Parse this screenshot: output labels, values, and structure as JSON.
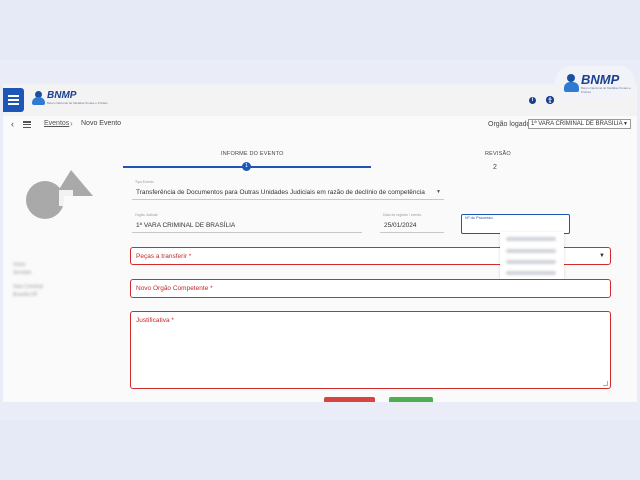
{
  "header": {
    "logo_name": "BNMP",
    "logo_sub": "Banco Nacional de Medidas Penais e Prisões",
    "info_icon": "i",
    "accessibility_icon": "accessibility-icon",
    "user_icon": "user-icon"
  },
  "breadcrumb": {
    "back_icon": "‹",
    "sep": "›",
    "link": "Eventos",
    "current": "Novo Evento"
  },
  "orgao": {
    "label": "Orgão logado:",
    "value": "1ª VARA CRIMINAL DE BRASÍLIA",
    "arrow": "▼"
  },
  "stepper": {
    "step1_label": "INFORME DO EVENTO",
    "step1_number": "1",
    "step2_label": "REVISÃO",
    "step2_number": "2"
  },
  "form": {
    "tipo_evento": {
      "label": "Tipo Evento",
      "value": "Transferência de Documentos para Outras Unidades Judiciais em razão de declínio de competência",
      "arrow": "▼"
    },
    "orgao_judicial": {
      "label": "Orgão Judicial",
      "value": "1ª VARA CRIMINAL DE BRASÍLIA"
    },
    "data_registro": {
      "label": "Data do registro / evento",
      "value": "25/01/2024"
    },
    "numero_processo": {
      "label": "Nº do Processo"
    },
    "pecas": {
      "label": "Peças a transferir *",
      "arrow": "▼"
    },
    "novo_orgao": {
      "label": "Novo Orgão Competente *"
    },
    "justificativa": {
      "label": "Justificativa *"
    }
  },
  "side_info": {
    "line1": "Victor",
    "line2": "Servidor",
    "line3": "Vara Criminal",
    "line4": "Brasília DF"
  },
  "colors": {
    "accent": "#1e56b8",
    "error": "#d22b2b",
    "cancel": "#d6453d",
    "confirm": "#4caf50"
  }
}
